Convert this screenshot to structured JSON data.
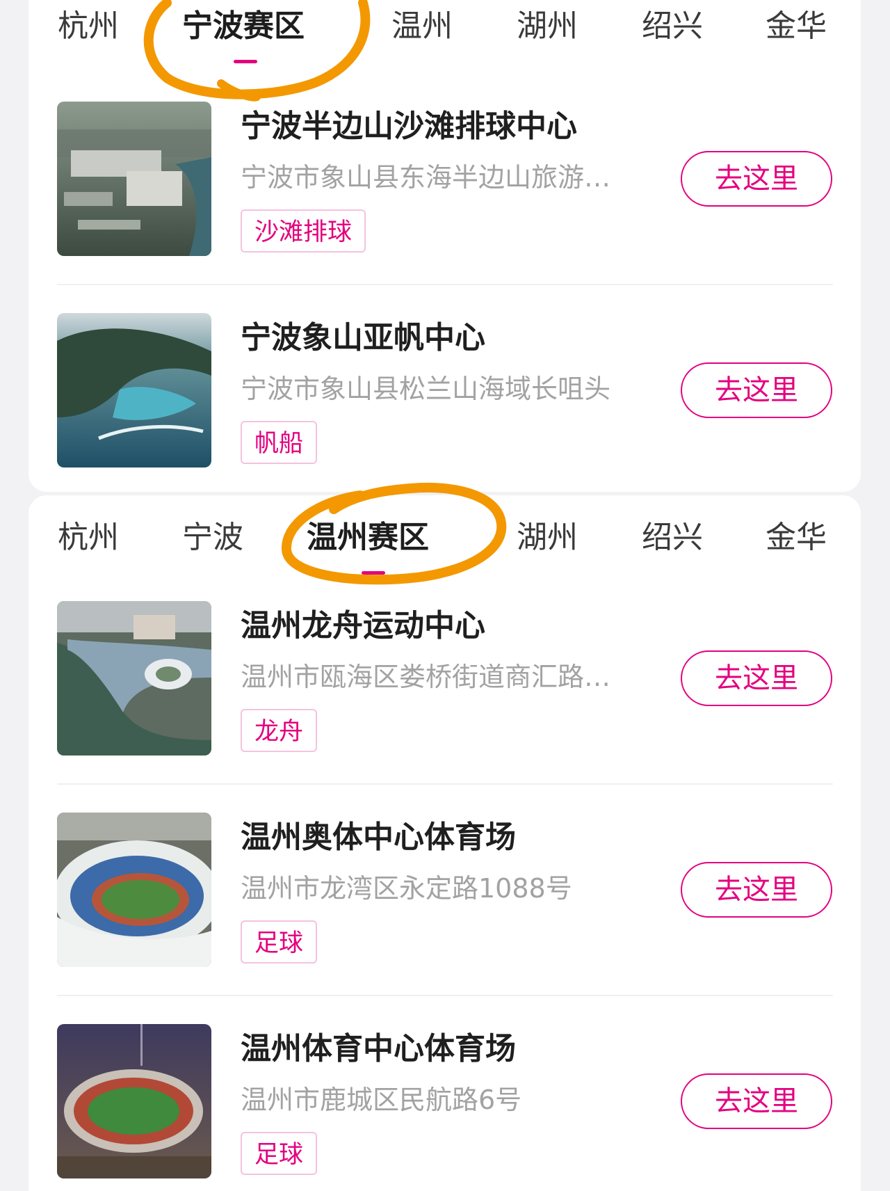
{
  "section_1": {
    "tabs": [
      {
        "label": "杭州",
        "active": false
      },
      {
        "label": "宁波赛区",
        "active": true
      },
      {
        "label": "温州",
        "active": false
      },
      {
        "label": "湖州",
        "active": false
      },
      {
        "label": "绍兴",
        "active": false
      },
      {
        "label": "金华",
        "active": false
      }
    ],
    "venues": [
      {
        "name": "宁波半边山沙滩排球中心",
        "address": "宁波市象山县东海半边山旅游…",
        "tag": "沙滩排球",
        "button": "去这里",
        "thumbnail_icon": "aerial-city-image"
      },
      {
        "name": "宁波象山亚帆中心",
        "address": "宁波市象山县松兰山海域长咀头",
        "tag": "帆船",
        "button": "去这里",
        "thumbnail_icon": "aerial-coast-image"
      }
    ]
  },
  "section_2": {
    "tabs": [
      {
        "label": "杭州",
        "active": false
      },
      {
        "label": "宁波",
        "active": false
      },
      {
        "label": "温州赛区",
        "active": true
      },
      {
        "label": "湖州",
        "active": false
      },
      {
        "label": "绍兴",
        "active": false
      },
      {
        "label": "金华",
        "active": false
      }
    ],
    "venues": [
      {
        "name": "温州龙舟运动中心",
        "address": "温州市瓯海区娄桥街道商汇路…",
        "tag": "龙舟",
        "button": "去这里",
        "thumbnail_icon": "aerial-river-image"
      },
      {
        "name": "温州奥体中心体育场",
        "address": "温州市龙湾区永定路1088号",
        "tag": "足球",
        "button": "去这里",
        "thumbnail_icon": "stadium-image"
      },
      {
        "name": "温州体育中心体育场",
        "address": "温州市鹿城区民航路6号",
        "tag": "足球",
        "button": "去这里",
        "thumbnail_icon": "stadium-night-image"
      }
    ]
  },
  "colors": {
    "accent": "#e4007f",
    "highlight_circle": "#f39800",
    "tag_border": "#f5c2dd",
    "page_background": "#f2f2f4"
  }
}
